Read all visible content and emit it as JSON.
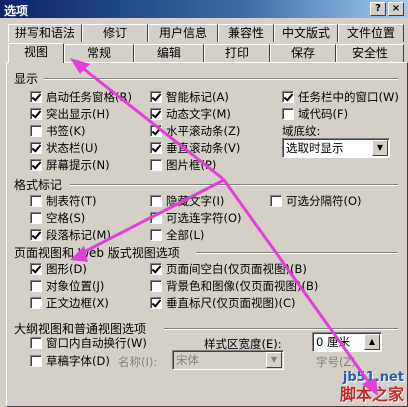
{
  "window": {
    "title": "选项",
    "help_btn": "?",
    "close_btn": "×"
  },
  "tabs_row1": [
    "拼写和语法",
    "修订",
    "用户信息",
    "兼容性",
    "中文版式",
    "文件位置"
  ],
  "tabs_row2": [
    "视图",
    "常规",
    "编辑",
    "打印",
    "保存",
    "安全性"
  ],
  "sections": {
    "show": "显示",
    "format": "格式标记",
    "pageview": "页面视图和 Web 版式视图选项",
    "outline": "大纲视图和普通视图选项"
  },
  "show": {
    "startup_task": "启动任务窗格(R)",
    "highlight": "突出显示(H)",
    "bookmark": "书签(K)",
    "statusbar": "状态栏(U)",
    "screentip": "屏幕提示(N)",
    "smarttag": "智能标记(A)",
    "animated": "动态文字(M)",
    "hscroll": "水平滚动条(Z)",
    "vscroll": "垂直滚动条(V)",
    "picture": "图片框(P)",
    "windows_in_taskbar": "任务栏中的窗口(W)",
    "field_codes": "域代码(F)",
    "field_shading_label": "域底纹:",
    "field_shading_value": "选取时显示"
  },
  "format": {
    "tab": "制表符(T)",
    "space": "空格(S)",
    "paragraph": "段落标记(M)",
    "hidden": "隐藏文字(I)",
    "optional_hyphen": "可选连字符(O)",
    "all": "全部(L)",
    "optional_break": "可选分隔符(O)"
  },
  "pageview": {
    "drawings": "图形(D)",
    "object_anchors": "对象位置(J)",
    "text_boundaries": "正文边框(X)",
    "white_space": "页面间空白(仅页面视图)(B)",
    "bg_colors": "背景色和图像(仅页面视图)(B)",
    "vertical_ruler": "垂直标尺(仅页面视图)(C)"
  },
  "outline": {
    "wrap": "窗口内自动换行(W)",
    "draft_font": "草稿字体(D)",
    "name_label": "名称(I):",
    "name_value": "宋体",
    "style_width_label": "样式区宽度(E):",
    "style_width_value": "0 厘米",
    "size_label": "字号(Z)"
  },
  "watermark": {
    "site": "jb51.net",
    "brand": "脚本之家"
  },
  "colors": {
    "arrow": "#e040d8",
    "title_bg": "#0a246a"
  }
}
